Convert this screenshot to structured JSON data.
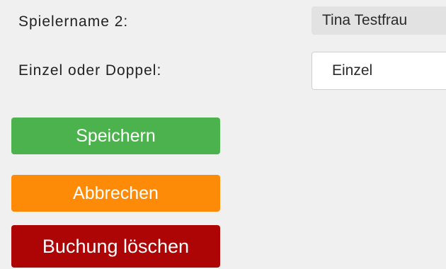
{
  "form": {
    "player_name_label": "Spielername 2:",
    "player_name_value": "Tina Testfrau",
    "match_type_label": "Einzel oder Doppel:",
    "match_type_value": "Einzel"
  },
  "actions": {
    "save_label": "Speichern",
    "cancel_label": "Abbrechen",
    "delete_label": "Buchung löschen"
  },
  "colors": {
    "background": "#f0f0f0",
    "save": "#4cb24e",
    "cancel": "#fe8b08",
    "delete": "#ad0505"
  }
}
